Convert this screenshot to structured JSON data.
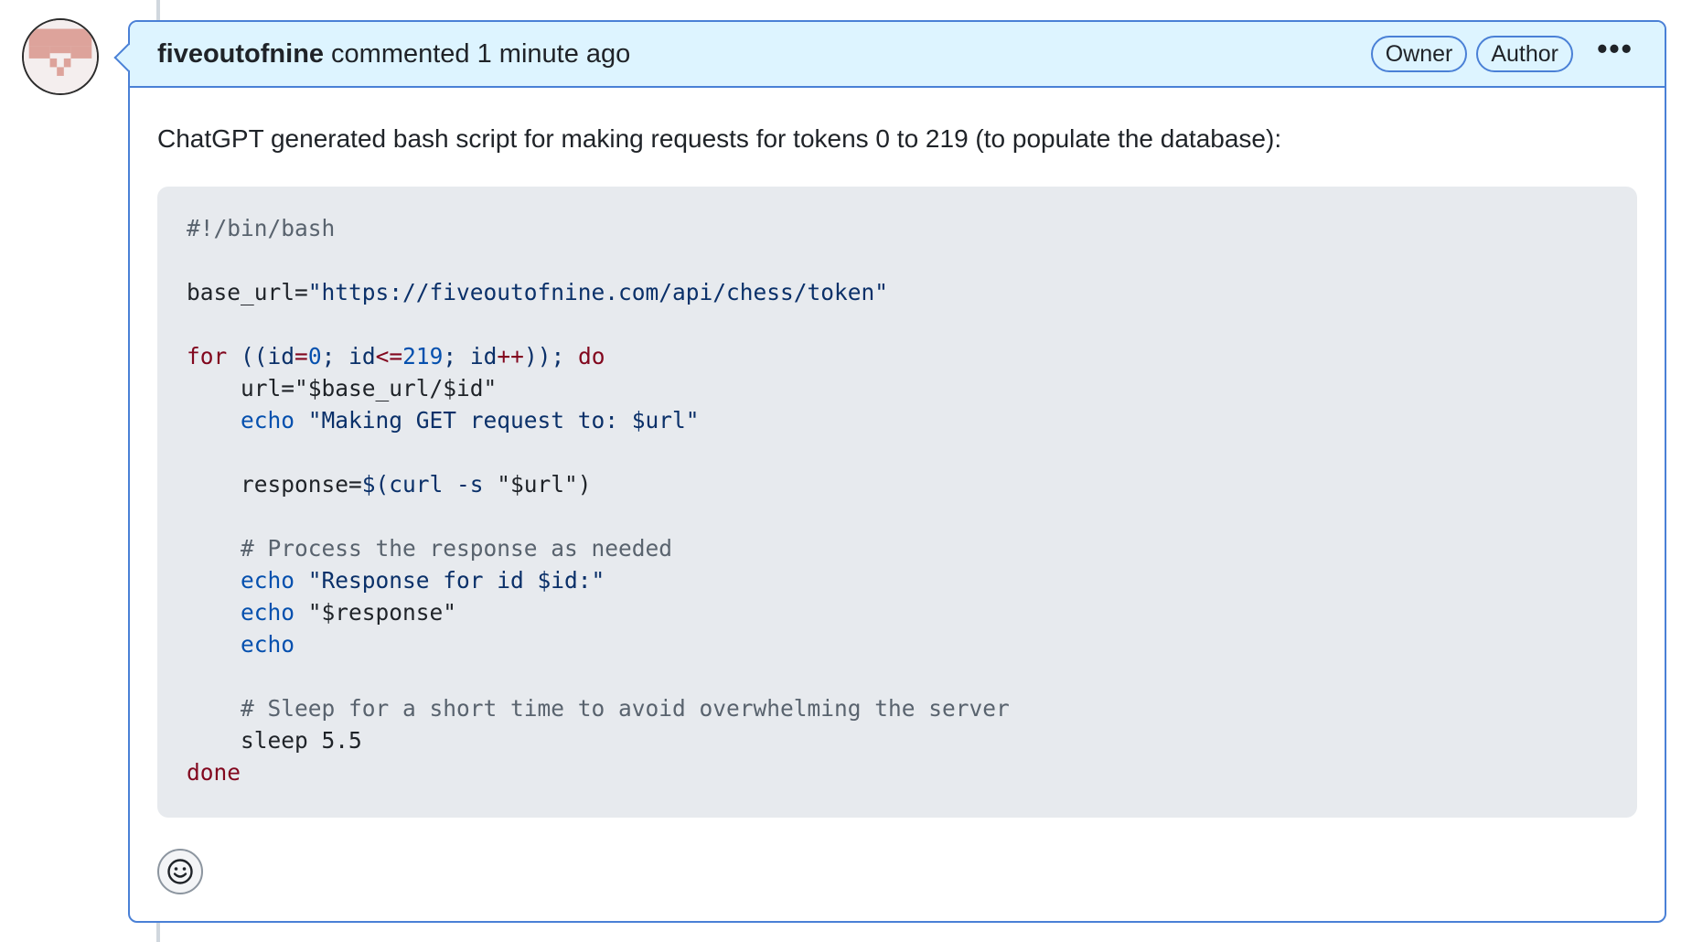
{
  "comment": {
    "author": "fiveoutofnine",
    "meta": "commented 1 minute ago",
    "badges": [
      "Owner",
      "Author"
    ],
    "more_label": "•••",
    "body_text": "ChatGPT generated bash script for making requests for tokens 0 to 219 (to populate the database):",
    "code_lines": [
      [
        {
          "t": "#!/bin/bash",
          "k": "comment"
        }
      ],
      [],
      [
        {
          "t": "base_url=",
          "k": "plain"
        },
        {
          "t": "\"https://fiveoutofnine.com/api/chess/token\"",
          "k": "string"
        }
      ],
      [],
      [
        {
          "t": "for",
          "k": "keyword"
        },
        {
          "t": " ((",
          "k": "string"
        },
        {
          "t": "id",
          "k": "string"
        },
        {
          "t": "=",
          "k": "keyword"
        },
        {
          "t": "0",
          "k": "builtin"
        },
        {
          "t": "; ",
          "k": "string"
        },
        {
          "t": "id",
          "k": "string"
        },
        {
          "t": "<=",
          "k": "keyword"
        },
        {
          "t": "219",
          "k": "builtin"
        },
        {
          "t": "; ",
          "k": "string"
        },
        {
          "t": "id",
          "k": "string"
        },
        {
          "t": "++",
          "k": "keyword"
        },
        {
          "t": ")); ",
          "k": "string"
        },
        {
          "t": "do",
          "k": "keyword"
        }
      ],
      [
        {
          "t": "    url=",
          "k": "plain"
        },
        {
          "t": "\"$base_url/$id\"",
          "k": "plain"
        }
      ],
      [
        {
          "t": "    ",
          "k": "plain"
        },
        {
          "t": "echo",
          "k": "builtin"
        },
        {
          "t": " \"Making GET request to: $url\"",
          "k": "string"
        }
      ],
      [],
      [
        {
          "t": "    response=",
          "k": "plain"
        },
        {
          "t": "$(curl -s",
          "k": "string"
        },
        {
          "t": " \"$url\")",
          "k": "plain"
        }
      ],
      [],
      [
        {
          "t": "    # Process the response as needed",
          "k": "comment"
        }
      ],
      [
        {
          "t": "    ",
          "k": "plain"
        },
        {
          "t": "echo",
          "k": "builtin"
        },
        {
          "t": " \"Response for id $id:\"",
          "k": "string"
        }
      ],
      [
        {
          "t": "    ",
          "k": "plain"
        },
        {
          "t": "echo",
          "k": "builtin"
        },
        {
          "t": " \"$response\"",
          "k": "plain"
        }
      ],
      [
        {
          "t": "    ",
          "k": "plain"
        },
        {
          "t": "echo",
          "k": "builtin"
        }
      ],
      [],
      [
        {
          "t": "    # Sleep for a short time to avoid overwhelming the server",
          "k": "comment"
        }
      ],
      [
        {
          "t": "    sleep 5.5",
          "k": "plain"
        }
      ],
      [
        {
          "t": "done",
          "k": "keyword"
        }
      ]
    ],
    "reaction_icon": "smiley-icon"
  },
  "colors": {
    "header_bg": "#ddf4ff",
    "border": "#4a80d6",
    "code_bg": "#e7eaee",
    "keyword": "#82071e",
    "string": "#0a3069",
    "builtin": "#0550ae",
    "comment": "#59636e"
  }
}
